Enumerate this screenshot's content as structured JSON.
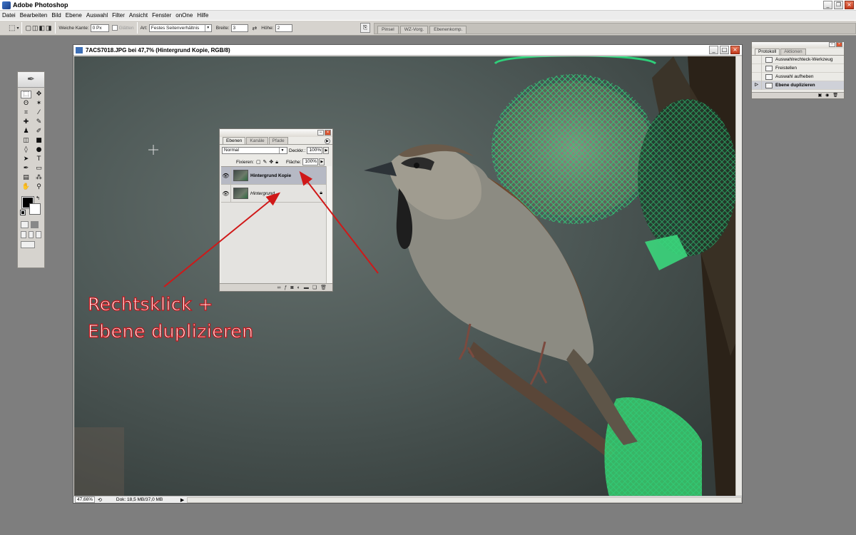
{
  "app": {
    "title": "Adobe Photoshop"
  },
  "menu": [
    "Datei",
    "Bearbeiten",
    "Bild",
    "Ebene",
    "Auswahl",
    "Filter",
    "Ansicht",
    "Fenster",
    "onOne",
    "Hilfe"
  ],
  "options": {
    "soft_edge_label": "Weiche Kante:",
    "soft_edge_value": "0 Px",
    "smooth_label": "Glätten",
    "style_label": "Art:",
    "style_value": "Festes Seitenverhältnis",
    "width_label": "Breite:",
    "width_value": "3",
    "height_label": "Höhe:",
    "height_value": "2",
    "well_tabs": [
      "Pinsel",
      "WZ-Vorg.",
      "Ebenenkomp."
    ]
  },
  "document": {
    "title": "7ACS7018.JPG bei 47,7% (Hintergrund Kopie, RGB/8)",
    "zoom": "47,66%",
    "doc_info": "Dok: 18,5 MB/37,0 MB"
  },
  "layers_panel": {
    "tabs": [
      "Ebenen",
      "Kanäle",
      "Pfade"
    ],
    "blend_mode": "Normal",
    "opacity_label": "Deckkr.:",
    "opacity_value": "100%",
    "lock_label": "Fixieren:",
    "fill_label": "Fläche:",
    "fill_value": "100%",
    "layers": [
      {
        "name": "Hintergrund Kopie",
        "selected": true
      },
      {
        "name": "Hintergrund",
        "selected": false
      }
    ]
  },
  "history_panel": {
    "tabs": [
      "Protokoll",
      "Aktionen"
    ],
    "items": [
      {
        "label": "Auswahlrechteck-Werkzeug",
        "selected": false
      },
      {
        "label": "Freistellen",
        "selected": false
      },
      {
        "label": "Auswahl aufheben",
        "selected": false
      },
      {
        "label": "Ebene duplizieren",
        "selected": true
      }
    ]
  },
  "annotation": {
    "line1": "Rechtsklick +",
    "line2": "Ebene duplizieren",
    "color": "#c4141a"
  }
}
